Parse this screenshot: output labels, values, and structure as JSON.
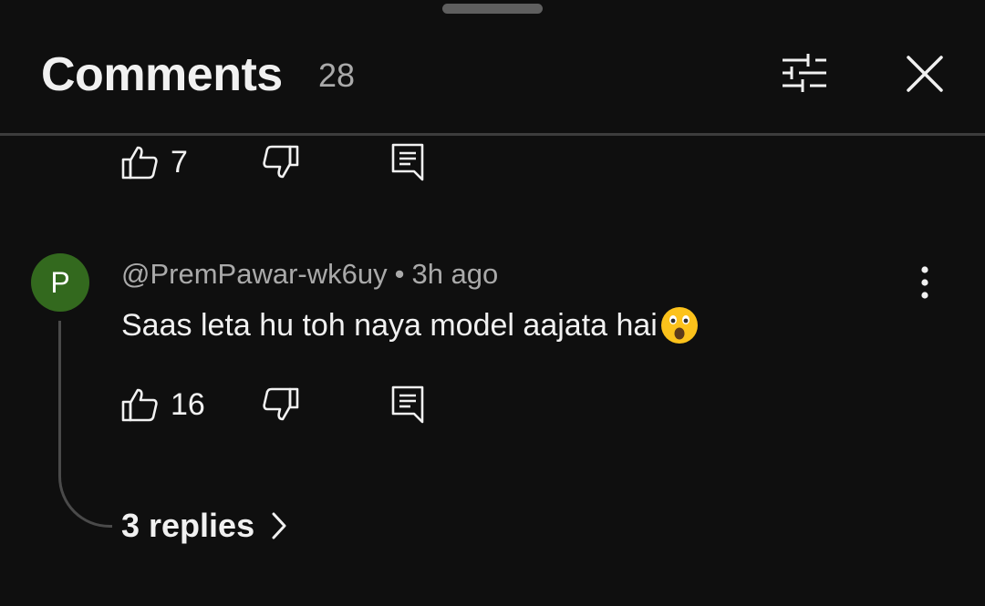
{
  "header": {
    "title": "Comments",
    "count": "28",
    "filter_icon": "sliders-icon",
    "close_icon": "close-icon"
  },
  "previous_comment": {
    "likes": "7",
    "like_icon": "thumb-up-icon",
    "dislike_icon": "thumb-down-icon",
    "reply_icon": "comment-icon"
  },
  "comment": {
    "avatar_letter": "P",
    "avatar_color": "#33691e",
    "author": "@PremPawar-wk6uy",
    "separator": "•",
    "time": "3h ago",
    "text": "Saas leta hu toh naya model aajata hai",
    "emoji": "astonished-face-emoji",
    "likes": "16",
    "more_icon": "more-vertical-icon",
    "replies_label": "3 replies",
    "replies_icon": "chevron-right-icon"
  },
  "colors": {
    "background": "#0f0f0f",
    "primary_text": "#f1f1f1",
    "secondary_text": "#aaaaaa"
  }
}
